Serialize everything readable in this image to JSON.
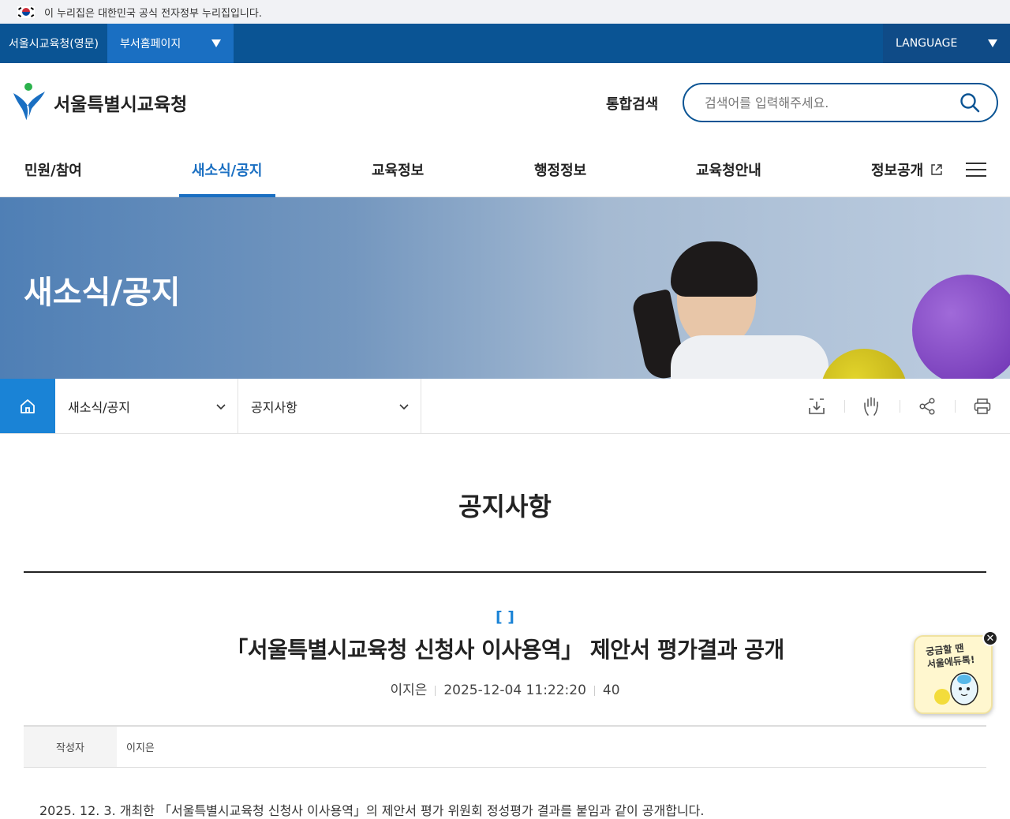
{
  "gov_banner": {
    "text": "이 누리집은 대한민국 공식 전자정부 누리집입니다."
  },
  "top_nav": {
    "english_site": "서울시교육청(영문)",
    "dept_homepage": "부서홈페이지",
    "language": "LANGUAGE"
  },
  "header": {
    "logo_text": "서울특별시교육청",
    "search_label": "통합검색",
    "search_placeholder": "검색어를 입력해주세요."
  },
  "gnb": {
    "items": [
      "민원/참여",
      "새소식/공지",
      "교육정보",
      "행정정보",
      "교육청안내",
      "정보공개"
    ],
    "active_index": 1
  },
  "hero": {
    "title": "새소식/공지"
  },
  "subbar": {
    "crumb_1": "새소식/공지",
    "crumb_2": "공지사항"
  },
  "tools": [
    "download-icon",
    "hand-icon",
    "share-icon",
    "print-icon"
  ],
  "page_title": "공지사항",
  "post": {
    "category": "[ ]",
    "title": "「서울특별시교육청 신청사 이사용역」 제안서 평가결과 공개",
    "author": "이지은",
    "date": "2025-12-04 11:22:20",
    "views": "40",
    "info_label": "작성자",
    "info_value": "이지은",
    "body_text": "2025. 12. 3. 개최한 「서울특별시교육청 신청사 이사용역」의 제안서 평가 위원회 정성평가 결과를 붙임과 같이 공개합니다."
  },
  "float_banner": {
    "text_line_1": "궁금할 땐",
    "text_line_2": "서울에듀톡!"
  },
  "colors": {
    "primary": "#0a5494",
    "accent": "#1a83d6",
    "active": "#1a6fc2"
  }
}
